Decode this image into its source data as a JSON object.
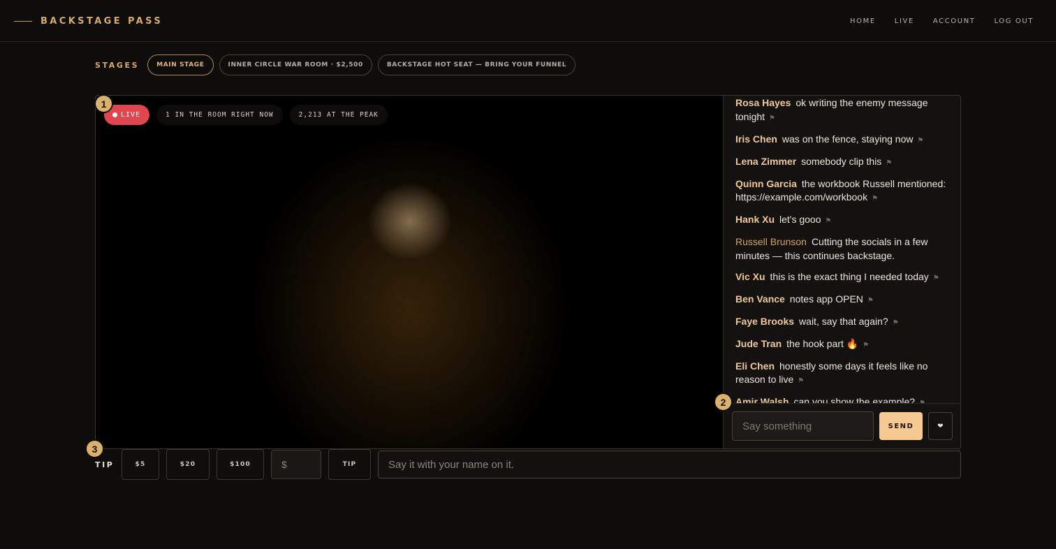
{
  "header": {
    "brand": "BACKSTAGE PASS",
    "nav": [
      "HOME",
      "LIVE",
      "ACCOUNT",
      "LOG OUT"
    ]
  },
  "stages": {
    "label": "STAGES",
    "items": [
      {
        "label": "MAIN STAGE",
        "active": true
      },
      {
        "label": "INNER CIRCLE WAR ROOM · $2,500",
        "active": false
      },
      {
        "label": "BACKSTAGE HOT SEAT — BRING YOUR FUNNEL",
        "active": false
      }
    ]
  },
  "player": {
    "live_label": "LIVE",
    "viewers_now": "1 IN THE ROOM RIGHT NOW",
    "viewers_peak": "2,213 AT THE PEAK"
  },
  "chat": {
    "messages": [
      {
        "user": "Rosa Hayes",
        "text": "ok writing the enemy message tonight",
        "host": false,
        "flag": "⚑"
      },
      {
        "user": "Iris Chen",
        "text": "was on the fence, staying now",
        "host": false,
        "flag": "⚑"
      },
      {
        "user": "Lena Zimmer",
        "text": "somebody clip this",
        "host": false,
        "flag": "⚑"
      },
      {
        "user": "Quinn Garcia",
        "text": "the workbook Russell mentioned: https://example.com/workbook",
        "host": false,
        "flag": "⚑"
      },
      {
        "user": "Hank Xu",
        "text": "let's gooo",
        "host": false,
        "flag": "⚑"
      },
      {
        "user": "Russell Brunson",
        "text": "Cutting the socials in a few minutes — this continues backstage.",
        "host": true,
        "flag": ""
      },
      {
        "user": "Vic Xu",
        "text": "this is the exact thing I needed today",
        "host": false,
        "flag": "⚑"
      },
      {
        "user": "Ben Vance",
        "text": "notes app OPEN",
        "host": false,
        "flag": "⚑"
      },
      {
        "user": "Faye Brooks",
        "text": "wait, say that again?",
        "host": false,
        "flag": "⚑"
      },
      {
        "user": "Jude Tran",
        "text": "the hook part 🔥",
        "host": false,
        "flag": "⚑"
      },
      {
        "user": "Eli Chen",
        "text": "honestly some days it feels like no reason to live",
        "host": false,
        "flag": "⚑"
      },
      {
        "user": "Amir Walsh",
        "text": "can you show the example?",
        "host": false,
        "flag": "⚑"
      }
    ],
    "input_placeholder": "Say something",
    "send_label": "SEND",
    "heart_label": "❤"
  },
  "tip": {
    "label": "TIP",
    "amounts": [
      "$5",
      "$20",
      "$100"
    ],
    "custom_placeholder": "$",
    "tip_button_label": "TIP",
    "message_placeholder": "Say it with your name on it."
  },
  "markers": [
    "1",
    "2",
    "3"
  ],
  "colors": {
    "background": "#0e0d0c",
    "accent": "#d8ab6a",
    "live": "#e0464f",
    "send": "#f5c98f"
  }
}
